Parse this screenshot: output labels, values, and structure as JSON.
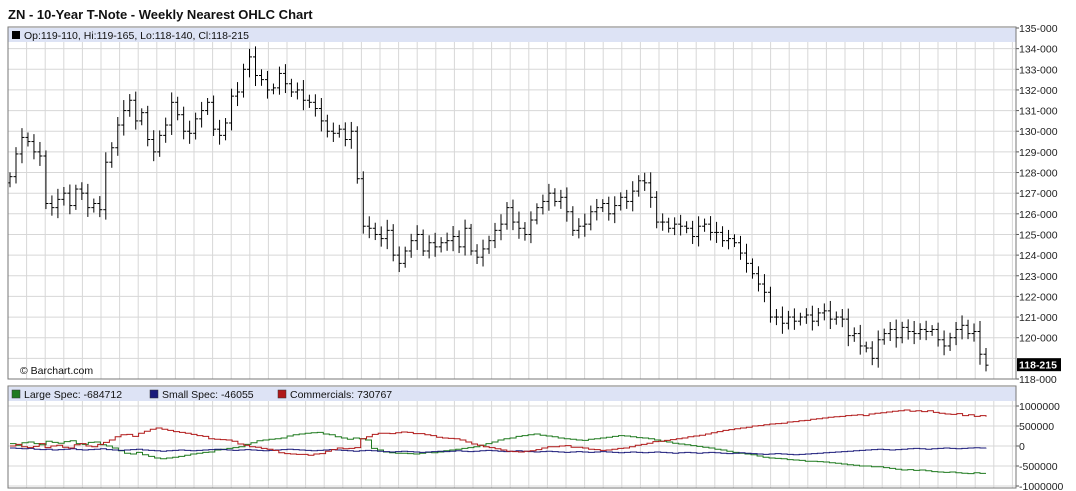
{
  "title": "ZN - 10-Year T-Note - Weekly Nearest OHLC Chart",
  "price_info": "Op:119-110, Hi:119-165, Lo:118-140, Cl:118-215",
  "watermark": "© Barchart.com",
  "last_price_label": "118-215",
  "colors": {
    "grid": "#d7d7d7",
    "header_band": "#dde3f5",
    "bars": "#000000",
    "large_spec": "#1f7a1f",
    "small_spec": "#1a1a7a",
    "commercials": "#b01818"
  },
  "chart_data": [
    {
      "type": "ohlc",
      "title": "ZN - 10-Year T-Note - Weekly Nearest OHLC Chart",
      "ylim": [
        118,
        135
      ],
      "y_ticks": [
        "135-000",
        "134-000",
        "133-000",
        "132-000",
        "131-000",
        "130-000",
        "129-000",
        "128-000",
        "127-000",
        "126-000",
        "125-000",
        "124-000",
        "123-000",
        "122-000",
        "121-000",
        "120-000",
        "118-000"
      ],
      "y_tick_values": [
        135,
        134,
        133,
        132,
        131,
        130,
        129,
        128,
        127,
        126,
        125,
        124,
        123,
        122,
        121,
        120,
        118
      ],
      "last_value": 118.67,
      "closes": [
        127.8,
        128.9,
        129.7,
        129.5,
        129.0,
        128.8,
        126.5,
        126.3,
        126.7,
        127.0,
        126.4,
        127.2,
        127.0,
        126.3,
        126.5,
        126.2,
        128.5,
        129.2,
        130.3,
        131.0,
        131.5,
        130.5,
        130.9,
        129.6,
        129.0,
        129.8,
        130.3,
        131.4,
        130.8,
        130.0,
        129.9,
        130.6,
        131.0,
        131.4,
        130.1,
        129.8,
        130.4,
        131.7,
        131.9,
        133.0,
        133.6,
        132.7,
        132.5,
        132.0,
        132.1,
        132.8,
        132.3,
        131.9,
        132.0,
        131.5,
        131.4,
        131.1,
        130.5,
        130.0,
        129.9,
        130.1,
        129.6,
        130.0,
        127.7,
        125.4,
        125.3,
        125.0,
        124.8,
        125.2,
        124.0,
        123.6,
        124.2,
        124.7,
        125.0,
        124.2,
        124.6,
        124.4,
        124.6,
        124.7,
        124.9,
        124.4,
        125.3,
        124.2,
        123.9,
        124.3,
        124.7,
        125.2,
        125.5,
        126.3,
        125.6,
        125.3,
        125.0,
        125.7,
        126.3,
        126.6,
        127.0,
        126.6,
        126.8,
        126.1,
        125.2,
        125.4,
        125.5,
        126.1,
        126.3,
        126.5,
        126.0,
        126.4,
        126.8,
        126.6,
        127.1,
        127.6,
        127.5,
        126.8,
        125.6,
        125.6,
        125.3,
        125.5,
        125.4,
        125.3,
        124.9,
        125.4,
        125.5,
        125.1,
        125.1,
        124.7,
        124.8,
        124.6,
        124.1,
        123.6,
        123.1,
        122.6,
        122.2,
        121.0,
        121.0,
        120.7,
        121.0,
        120.8,
        121.0,
        121.1,
        120.8,
        121.2,
        121.3,
        120.9,
        121.0,
        120.9,
        120.1,
        120.2,
        119.6,
        119.5,
        119.0,
        119.9,
        120.2,
        120.4,
        120.0,
        120.5,
        120.3,
        120.2,
        120.4,
        120.3,
        120.4,
        119.9,
        119.6,
        120.0,
        120.4,
        120.6,
        120.2,
        120.3,
        119.2,
        118.67
      ]
    },
    {
      "type": "line",
      "ylim": [
        -1000000,
        1000000
      ],
      "y_ticks": [
        "1000000",
        "500000",
        "0",
        "-500000",
        "-1000000"
      ],
      "y_tick_values": [
        1000000,
        500000,
        0,
        -500000,
        -1000000
      ],
      "series": [
        {
          "name": "Large Spec",
          "last_value": -684712,
          "color": "#1f7a1f",
          "values": [
            60000,
            20000,
            80000,
            100000,
            60000,
            30000,
            120000,
            90000,
            70000,
            110000,
            130000,
            60000,
            40000,
            90000,
            100000,
            30000,
            0,
            -50000,
            -120000,
            -180000,
            -200000,
            -160000,
            -220000,
            -260000,
            -300000,
            -320000,
            -300000,
            -280000,
            -260000,
            -230000,
            -200000,
            -180000,
            -160000,
            -150000,
            -100000,
            -80000,
            -60000,
            -40000,
            -20000,
            40000,
            80000,
            130000,
            150000,
            170000,
            180000,
            200000,
            250000,
            280000,
            300000,
            320000,
            330000,
            340000,
            300000,
            280000,
            230000,
            200000,
            170000,
            200000,
            180000,
            150000,
            -60000,
            -100000,
            -150000,
            -170000,
            -180000,
            -180000,
            -190000,
            -200000,
            -180000,
            -160000,
            -170000,
            -150000,
            -120000,
            -100000,
            -80000,
            -60000,
            -40000,
            -20000,
            20000,
            60000,
            100000,
            150000,
            180000,
            200000,
            240000,
            260000,
            280000,
            300000,
            270000,
            250000,
            230000,
            200000,
            180000,
            170000,
            150000,
            140000,
            170000,
            180000,
            200000,
            220000,
            240000,
            260000,
            250000,
            230000,
            210000,
            200000,
            180000,
            150000,
            120000,
            100000,
            70000,
            50000,
            30000,
            10000,
            -10000,
            -30000,
            -50000,
            -80000,
            -100000,
            -130000,
            -160000,
            -180000,
            -200000,
            -220000,
            -250000,
            -280000,
            -300000,
            -310000,
            -320000,
            -340000,
            -350000,
            -360000,
            -380000,
            -380000,
            -390000,
            -400000,
            -420000,
            -430000,
            -450000,
            -470000,
            -480000,
            -500000,
            -500000,
            -520000,
            -520000,
            -540000,
            -560000,
            -580000,
            -600000,
            -590000,
            -610000,
            -600000,
            -620000,
            -640000,
            -650000,
            -660000,
            -650000,
            -670000,
            -680000,
            -690000,
            -670000,
            -685000,
            -684712
          ]
        },
        {
          "name": "Small Spec",
          "last_value": -46055,
          "color": "#1a1a7a",
          "values": [
            -50000,
            -60000,
            -70000,
            -60000,
            -80000,
            -90000,
            -80000,
            -100000,
            -90000,
            -80000,
            -70000,
            -90000,
            -100000,
            -90000,
            -80000,
            -70000,
            -90000,
            -100000,
            -110000,
            -100000,
            -90000,
            -80000,
            -100000,
            -110000,
            -120000,
            -130000,
            -120000,
            -110000,
            -100000,
            -110000,
            -120000,
            -110000,
            -100000,
            -90000,
            -80000,
            -90000,
            -100000,
            -110000,
            -100000,
            -90000,
            -100000,
            -110000,
            -120000,
            -110000,
            -100000,
            -90000,
            -80000,
            -90000,
            -100000,
            -110000,
            -120000,
            -110000,
            -100000,
            -90000,
            -100000,
            -110000,
            -120000,
            -130000,
            -120000,
            -110000,
            -120000,
            -130000,
            -140000,
            -150000,
            -140000,
            -130000,
            -140000,
            -150000,
            -160000,
            -150000,
            -140000,
            -130000,
            -140000,
            -130000,
            -120000,
            -130000,
            -140000,
            -130000,
            -120000,
            -110000,
            -120000,
            -130000,
            -140000,
            -130000,
            -120000,
            -130000,
            -140000,
            -150000,
            -140000,
            -130000,
            -140000,
            -150000,
            -160000,
            -150000,
            -140000,
            -150000,
            -160000,
            -150000,
            -140000,
            -150000,
            -160000,
            -170000,
            -160000,
            -150000,
            -160000,
            -170000,
            -160000,
            -150000,
            -160000,
            -170000,
            -180000,
            -170000,
            -160000,
            -170000,
            -180000,
            -170000,
            -160000,
            -170000,
            -180000,
            -190000,
            -180000,
            -170000,
            -180000,
            -190000,
            -200000,
            -210000,
            -200000,
            -190000,
            -200000,
            -210000,
            -220000,
            -210000,
            -200000,
            -190000,
            -180000,
            -170000,
            -160000,
            -150000,
            -140000,
            -130000,
            -120000,
            -110000,
            -100000,
            -90000,
            -80000,
            -90000,
            -100000,
            -90000,
            -80000,
            -70000,
            -60000,
            -70000,
            -80000,
            -70000,
            -60000,
            -50000,
            -60000,
            -70000,
            -60000,
            -50000,
            -45000,
            -50000,
            -46055
          ]
        },
        {
          "name": "Commercials",
          "last_value": 730767,
          "color": "#b01818",
          "values": [
            0,
            40000,
            -20000,
            -40000,
            -10000,
            60000,
            -40000,
            0,
            20000,
            -30000,
            -50000,
            30000,
            60000,
            0,
            -20000,
            40000,
            90000,
            150000,
            230000,
            280000,
            290000,
            240000,
            320000,
            370000,
            420000,
            450000,
            420000,
            390000,
            360000,
            340000,
            320000,
            290000,
            260000,
            240000,
            180000,
            170000,
            160000,
            150000,
            120000,
            50000,
            20000,
            -20000,
            -30000,
            -60000,
            -80000,
            -110000,
            -170000,
            -190000,
            -200000,
            -210000,
            -210000,
            -230000,
            -200000,
            -190000,
            -130000,
            -90000,
            -50000,
            -70000,
            -60000,
            -40000,
            180000,
            230000,
            290000,
            320000,
            320000,
            310000,
            330000,
            350000,
            340000,
            310000,
            310000,
            280000,
            260000,
            220000,
            200000,
            190000,
            180000,
            150000,
            100000,
            50000,
            20000,
            -20000,
            -40000,
            -70000,
            -100000,
            -130000,
            -140000,
            -150000,
            -130000,
            -120000,
            -90000,
            -50000,
            -20000,
            -20000,
            0,
            10000,
            -30000,
            -30000,
            -50000,
            -80000,
            -90000,
            -110000,
            -100000,
            -80000,
            -60000,
            -50000,
            -20000,
            20000,
            40000,
            70000,
            110000,
            120000,
            140000,
            160000,
            180000,
            200000,
            230000,
            250000,
            270000,
            300000,
            330000,
            360000,
            390000,
            410000,
            430000,
            450000,
            470000,
            500000,
            510000,
            530000,
            550000,
            560000,
            570000,
            600000,
            610000,
            630000,
            640000,
            670000,
            680000,
            700000,
            720000,
            730000,
            740000,
            760000,
            770000,
            780000,
            760000,
            800000,
            820000,
            830000,
            850000,
            870000,
            880000,
            900000,
            870000,
            880000,
            860000,
            880000,
            840000,
            820000,
            800000,
            790000,
            810000,
            760000,
            780000,
            740000,
            760000,
            730767
          ]
        }
      ]
    }
  ],
  "legend": [
    {
      "label": "Large Spec: -684712",
      "color": "#1f7a1f"
    },
    {
      "label": "Small Spec: -46055",
      "color": "#1a1a7a"
    },
    {
      "label": "Commercials: 730767",
      "color": "#b01818"
    }
  ]
}
